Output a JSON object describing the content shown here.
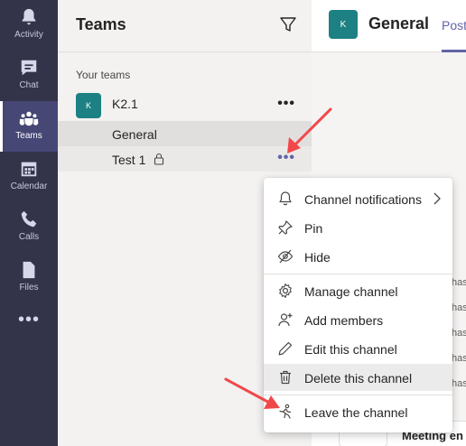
{
  "rail": {
    "items": [
      {
        "label": "Activity",
        "icon": "bell-icon"
      },
      {
        "label": "Chat",
        "icon": "chat-icon"
      },
      {
        "label": "Teams",
        "icon": "teams-icon",
        "active": true
      },
      {
        "label": "Calendar",
        "icon": "calendar-icon"
      },
      {
        "label": "Calls",
        "icon": "phone-icon"
      },
      {
        "label": "Files",
        "icon": "file-icon"
      }
    ],
    "more": "•••"
  },
  "pane": {
    "title": "Teams",
    "section_label": "Your teams",
    "team": {
      "avatar": "K",
      "name": "K2.1",
      "more": "•••"
    },
    "channels": [
      {
        "name": "General"
      },
      {
        "name": "Test 1",
        "private": true,
        "more": "•••"
      }
    ]
  },
  "main": {
    "avatar": "K",
    "channel_title": "General",
    "tab": "Posts",
    "tab_visible": "Post",
    "background_text": [
      "has",
      "has",
      "has",
      "has",
      "has"
    ],
    "meeting_text": "Meeting en"
  },
  "menu": {
    "items": [
      {
        "label": "Channel notifications",
        "icon": "bell-outline-icon",
        "submenu": true
      },
      {
        "label": "Pin",
        "icon": "pin-icon"
      },
      {
        "label": "Hide",
        "icon": "eye-off-icon"
      },
      {
        "label": "Manage channel",
        "icon": "gear-icon"
      },
      {
        "label": "Add members",
        "icon": "add-person-icon"
      },
      {
        "label": "Edit this channel",
        "icon": "pencil-icon"
      },
      {
        "label": "Delete this channel",
        "icon": "trash-icon",
        "highlighted": true
      },
      {
        "label": "Leave the channel",
        "icon": "leave-icon"
      }
    ]
  },
  "colors": {
    "rail_bg": "#33344a",
    "rail_active": "#464775",
    "accent": "#6264a7",
    "team_avatar": "#1d8083",
    "arrow": "#f0484a"
  }
}
